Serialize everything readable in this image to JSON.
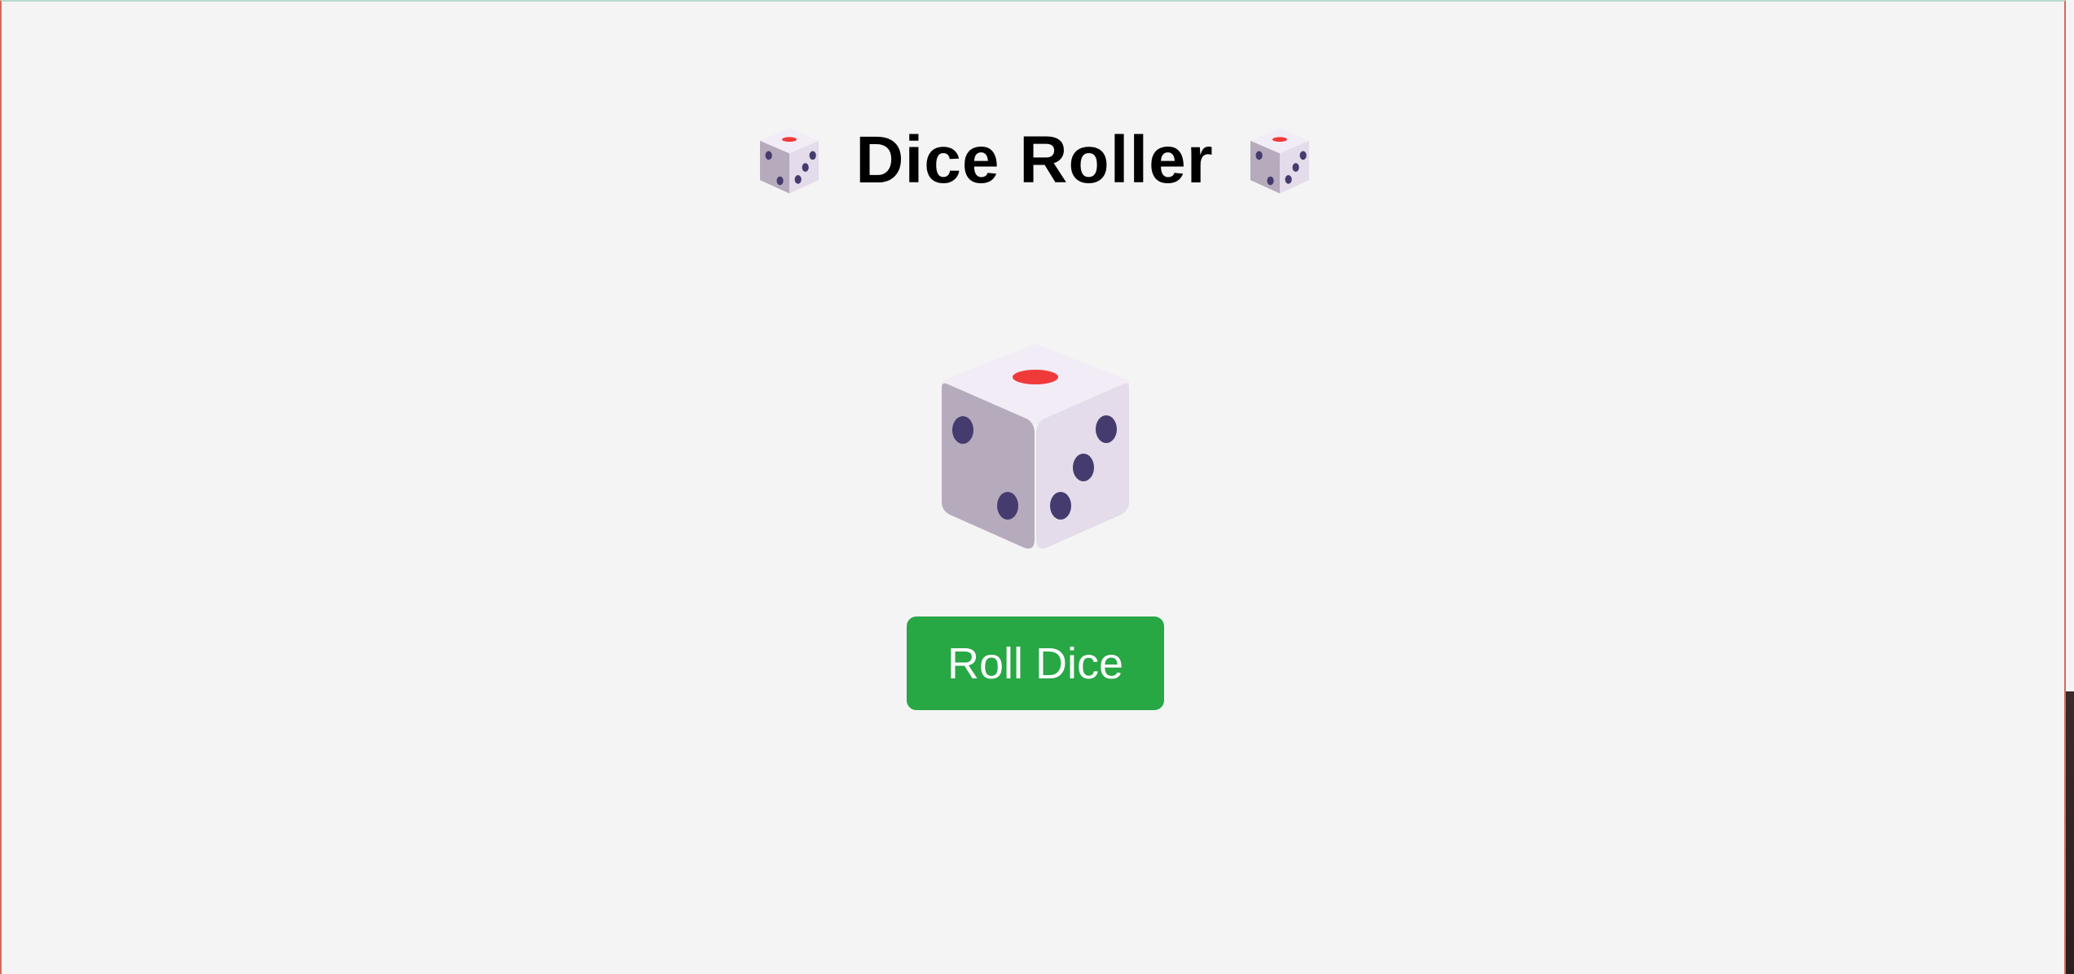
{
  "page": {
    "title": "Dice Roller",
    "title_left_icon": "game-die-icon",
    "title_right_icon": "game-die-icon"
  },
  "die": {
    "icon": "game-die-icon"
  },
  "roll_button": {
    "label": "Roll Dice"
  },
  "colors": {
    "background": "#f4f4f4",
    "button": "#28a745",
    "button_text": "#ffffff",
    "title_text": "#000000",
    "die_pip": "#463b6e",
    "die_top_pip": "#f03a3a"
  }
}
